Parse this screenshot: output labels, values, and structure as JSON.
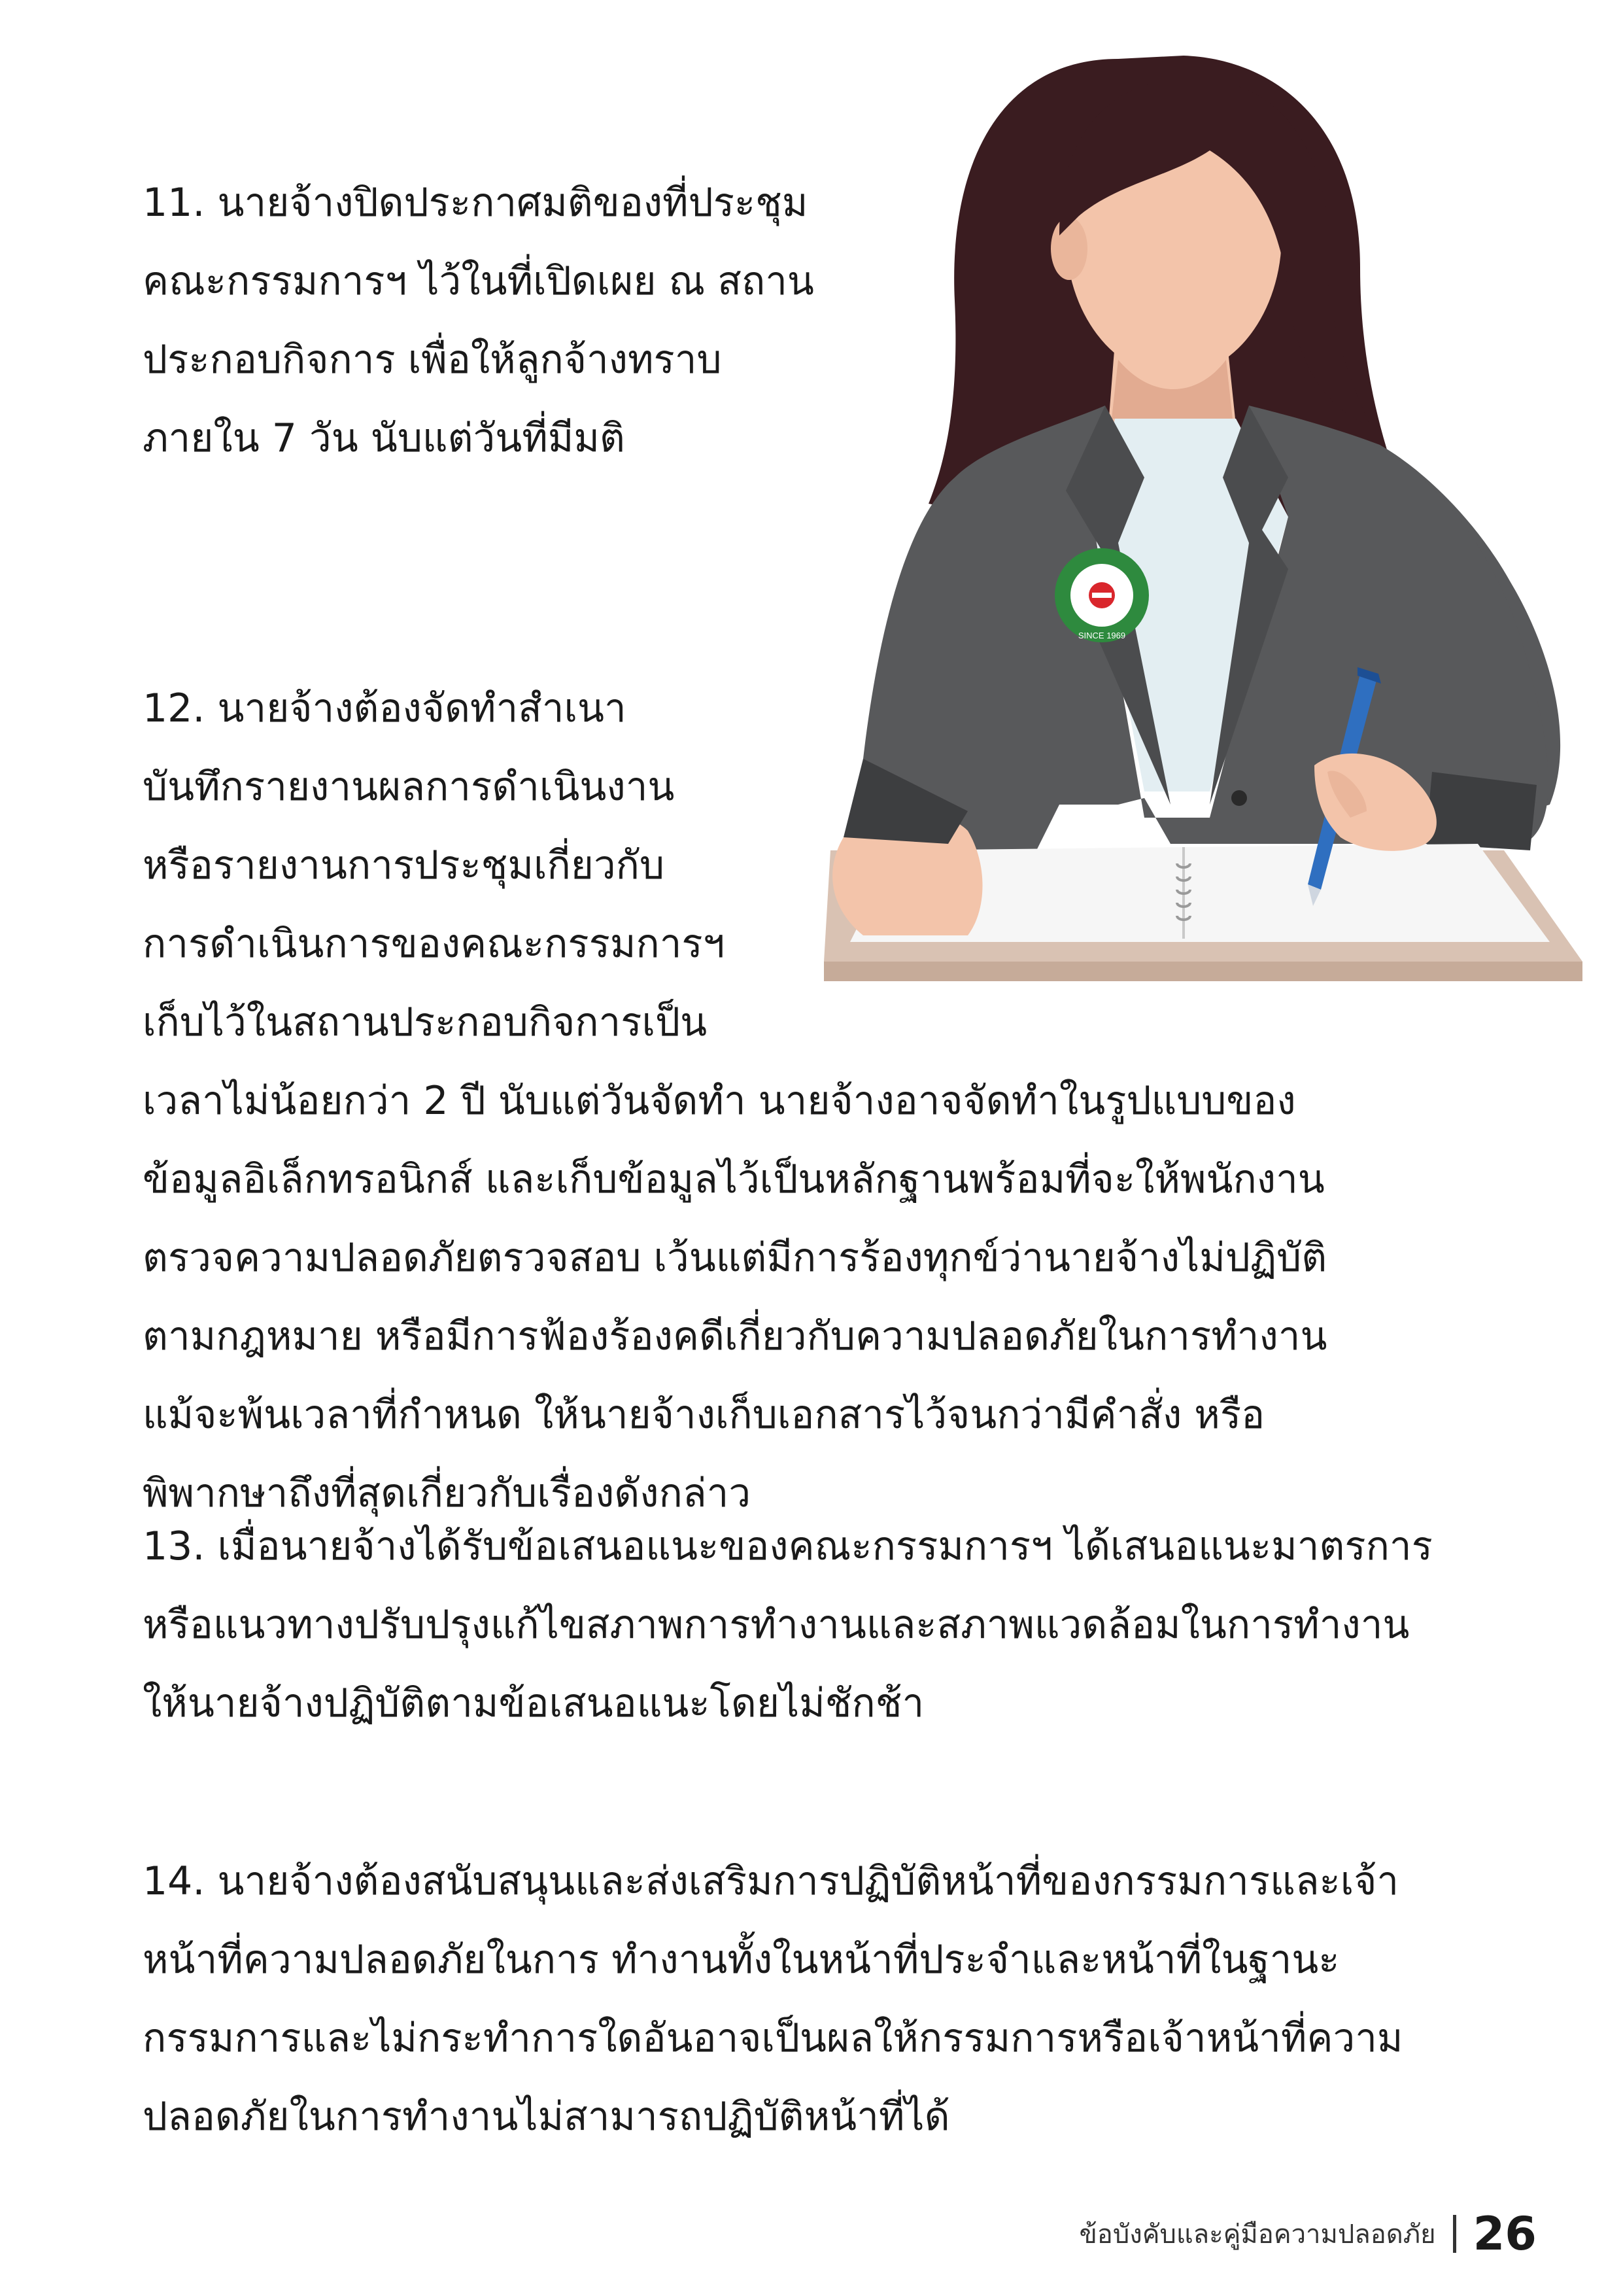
{
  "paragraphs": [
    {
      "lines": [
        "11. นายจ้างปิดประกาศมติของที่ประชุม",
        "คณะกรรมการฯ ไว้ในที่เปิดเผย ณ สถาน",
        "ประกอบกิจการ เพื่อให้ลูกจ้างทราบ",
        "ภายใน 7 วัน นับแต่วันที่มีมติ"
      ]
    },
    {
      "lines": [
        "12. นายจ้างต้องจัดทำสำเนา",
        "บันทึกรายงานผลการดำเนินงาน",
        "หรือรายงานการประชุมเกี่ยวกับ",
        "การดำเนินการของคณะกรรมการฯ",
        "เก็บไว้ในสถานประกอบกิจการเป็น",
        "เวลาไม่น้อยกว่า 2 ปี นับแต่วันจัดทำ นายจ้างอาจจัดทำในรูปแบบของ",
        "ข้อมูลอิเล็กทรอนิกส์ และเก็บข้อมูลไว้เป็นหลักฐานพร้อมที่จะให้พนักงาน",
        "ตรวจความปลอดภัยตรวจสอบ เว้นแต่มีการร้องทุกข์ว่านายจ้างไม่ปฏิบัติ",
        "ตามกฎหมาย หรือมีการฟ้องร้องคดีเกี่ยวกับความปลอดภัยในการทำงาน",
        "แม้จะพ้นเวลาที่กำหนด ให้นายจ้างเก็บเอกสารไว้จนกว่ามีคำสั่ง หรือ",
        "พิพากษาถึงที่สุดเกี่ยวกับเรื่องดังกล่าว"
      ]
    },
    {
      "lines": [
        "13. เมื่อนายจ้างได้รับข้อเสนอแนะของคณะกรรมการฯ ได้เสนอแนะมาตรการ",
        "หรือแนวทางปรับปรุงแก้ไขสภาพการทำงานและสภาพแวดล้อมในการทำงาน",
        "ให้นายจ้างปฏิบัติตามข้อเสนอแนะโดยไม่ชักช้า"
      ]
    },
    {
      "lines": [
        "14. นายจ้างต้องสนับสนุนและส่งเสริมการปฏิบัติหน้าที่ของกรรมการและเจ้า",
        "หน้าที่ความปลอดภัยในการ ทำงานทั้งในหน้าที่ประจำและหน้าที่ในฐานะ",
        "กรรมการและไม่กระทำการใดอันอาจเป็นผลให้กรรมการหรือเจ้าหน้าที่ความ",
        "ปลอดภัยในการทำงานไม่สามารถปฏิบัติหน้าที่ได้"
      ]
    }
  ],
  "illustration": {
    "badge_text": "SINCE 1969",
    "colors": {
      "hair": "#3a1c20",
      "skin": "#f3c4aa",
      "jacket": "#58595b",
      "shirt": "#e3eef2",
      "badge_ring": "#2e8a3e",
      "pen": "#2f6fc0",
      "desk": "#d9c2b3",
      "notebook": "#f6f6f6"
    }
  },
  "footer": {
    "text": "ข้อบังคับและคู่มือความปลอดภัย",
    "page_number": "26"
  }
}
